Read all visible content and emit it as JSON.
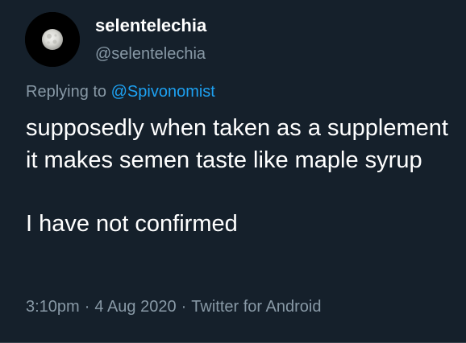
{
  "tweet": {
    "display_name": "selentelechia",
    "handle": "@selentelechia",
    "replying_prefix": "Replying to",
    "replying_to": "@Spivonomist",
    "body_line1": "supposedly when taken as a supplement it makes semen taste like maple syrup",
    "body_line2": "I have not confirmed",
    "time": "3:10pm",
    "date": "4 Aug 2020",
    "source": "Twitter for Android",
    "separator": "·"
  },
  "avatar_icon": "moon-icon",
  "colors": {
    "background": "#15202b",
    "text": "#ffffff",
    "secondary": "#8899a6",
    "link": "#1da1f2"
  }
}
